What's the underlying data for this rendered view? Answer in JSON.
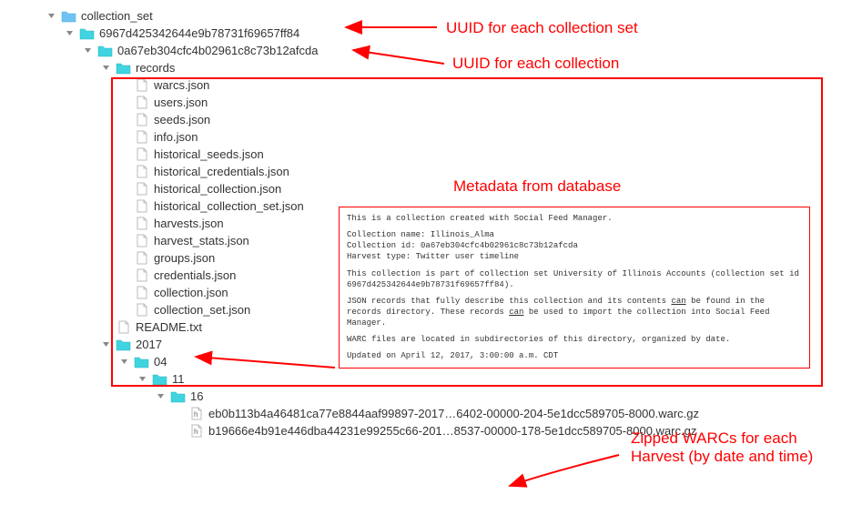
{
  "tree": {
    "root": {
      "label": "collection_set"
    },
    "uuid_set": {
      "label": "6967d425342644e9b78731f69657ff84"
    },
    "uuid_coll": {
      "label": "0a67eb304cfc4b02961c8c73b12afcda"
    },
    "records": {
      "label": "records"
    },
    "files": [
      "warcs.json",
      "users.json",
      "seeds.json",
      "info.json",
      "historical_seeds.json",
      "historical_credentials.json",
      "historical_collection.json",
      "historical_collection_set.json",
      "harvests.json",
      "harvest_stats.json",
      "groups.json",
      "credentials.json",
      "collection.json",
      "collection_set.json"
    ],
    "readme": {
      "label": "README.txt"
    },
    "year": {
      "label": "2017"
    },
    "month": {
      "label": "04"
    },
    "day": {
      "label": "11"
    },
    "hour": {
      "label": "16"
    },
    "warcs": [
      "eb0b113b4a46481ca77e8844aaf99897-2017…6402-00000-204-5e1dcc589705-8000.warc.gz",
      "b19666e4b91e446dba44231e99255c66-201…8537-00000-178-5e1dcc589705-8000.warc.gz"
    ]
  },
  "annotations": {
    "uuid_set": "UUID for each collection set",
    "uuid_coll": "UUID for each collection",
    "metadata": "Metadata from database",
    "warcs_l1": "Zipped WARCs for each",
    "warcs_l2": "Harvest (by date and time)"
  },
  "readme_content": {
    "l1": "This is a collection created with Social Feed Manager.",
    "l2a": "Collection name: Illinois_Alma",
    "l2b": "Collection id: 0a67eb304cfc4b02961c8c73b12afcda",
    "l2c": "Harvest type: Twitter user timeline",
    "l3": "This collection is part of collection set University of Illinois Accounts (collection set id 6967d425342644e9b78731f69657ff84).",
    "l4a": "JSON records that fully describe this collection and its contents ",
    "l4b": " be found in the records directory. These records ",
    "l4c": " be used to import the collection into Social Feed Manager.",
    "can": "can",
    "l5": "WARC files are located in subdirectories of this directory, organized by date.",
    "l6": "Updated on April 12, 2017, 3:00:00 a.m. CDT"
  }
}
